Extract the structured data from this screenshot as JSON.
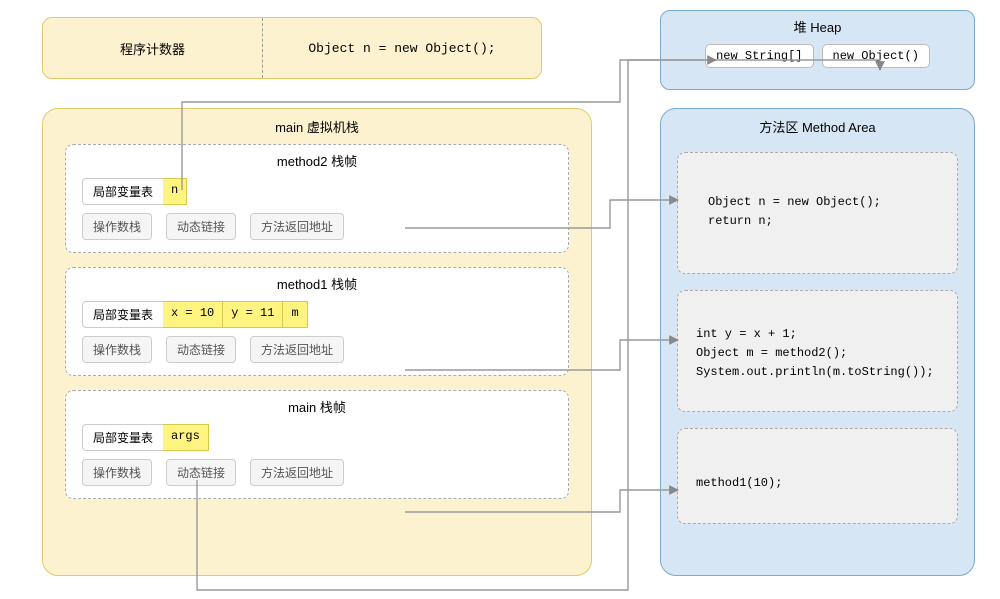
{
  "pc": {
    "label": "程序计数器",
    "code": "Object n = new Object();"
  },
  "heap": {
    "title": "堆 Heap",
    "items": [
      "new String[]",
      "new Object()"
    ]
  },
  "vmstack": {
    "title": "main 虚拟机栈",
    "frames": [
      {
        "title": "method2 栈帧",
        "lvt_label": "局部变量表",
        "lvt": [
          "n"
        ],
        "row2": [
          "操作数栈",
          "动态链接",
          "方法返回地址"
        ]
      },
      {
        "title": "method1 栈帧",
        "lvt_label": "局部变量表",
        "lvt": [
          "x = 10",
          "y = 11",
          "m"
        ],
        "row2": [
          "操作数栈",
          "动态链接",
          "方法返回地址"
        ]
      },
      {
        "title": "main 栈帧",
        "lvt_label": "局部变量表",
        "lvt": [
          "args"
        ],
        "row2": [
          "操作数栈",
          "动态链接",
          "方法返回地址"
        ]
      }
    ]
  },
  "method_area": {
    "title": "方法区 Method Area",
    "blocks": [
      "Object n = new Object();\nreturn n;",
      "int y = x + 1;\nObject m = method2();\nSystem.out.println(m.toString());",
      "method1(10);"
    ]
  }
}
